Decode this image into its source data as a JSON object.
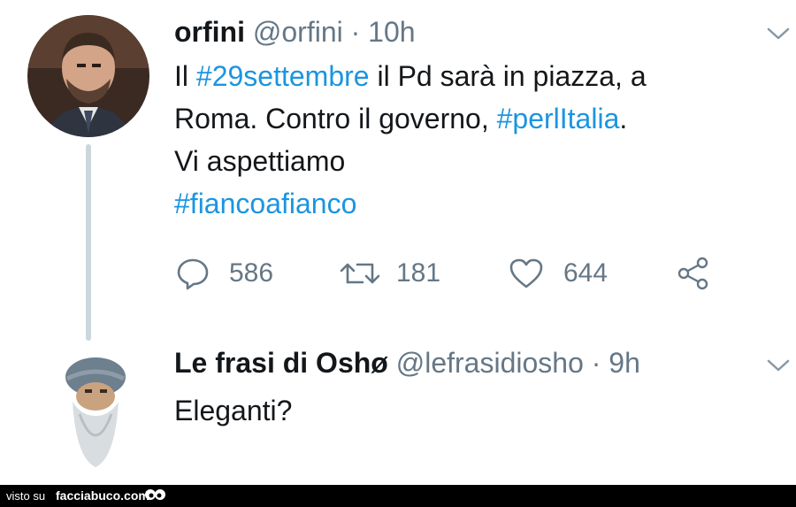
{
  "tweet1": {
    "display_name": "orfini",
    "handle": "@orfini",
    "separator": "·",
    "time": "10h",
    "text": {
      "line1_pre": "Il ",
      "line1_tag": "#29settembre",
      "line1_post": " il Pd sarà in piazza, a",
      "line2_pre": "Roma. Contro il governo, ",
      "line2_tag": "#perlItalia",
      "line2_post": ".",
      "line3": "Vi aspettiamo",
      "line4_tag": "#fiancoafianco"
    },
    "replies": "586",
    "retweets": "181",
    "likes": "644"
  },
  "tweet2": {
    "display_name": "Le frasi di Oshø",
    "handle": "@lefrasidiosho",
    "separator": "·",
    "time": "9h",
    "text": "Eleganti?"
  },
  "footer": {
    "prefix": "visto su",
    "site": "facciabuco.com"
  },
  "colors": {
    "hashtag": "#1b95e0",
    "meta": "#657786",
    "thread_line": "#ccd6dd"
  },
  "icons": [
    "reply-icon",
    "retweet-icon",
    "like-icon",
    "share-icon",
    "chevron-down-icon"
  ]
}
